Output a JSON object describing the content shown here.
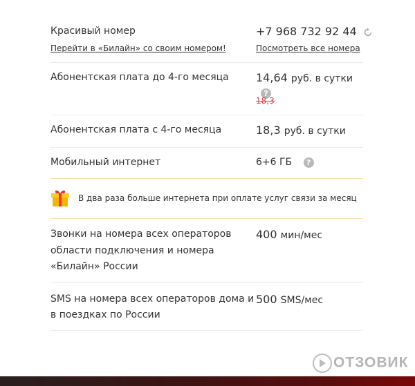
{
  "number_block": {
    "label": "Красивый номер",
    "link": "Перейти в «Билайн» со своим номером!",
    "phone": "+7 968 732 92 44",
    "all_numbers_link": "Посмотреть все номера"
  },
  "fee_before": {
    "label": "Абонентская плата до 4-го месяца",
    "value": "14,64",
    "unit": "руб. в сутки",
    "old_value": "18,3"
  },
  "fee_after": {
    "label": "Абонентская плата с 4-го месяца",
    "value": "18,3",
    "unit": "руб. в сутки"
  },
  "internet": {
    "label": "Мобильный интернет",
    "value": "6+6 ГБ"
  },
  "promo": {
    "text": "В два раза больше интернета при оплате услуг связи за месяц"
  },
  "calls": {
    "label_line1": "Звонки на номера всех операторов",
    "label_line2": "области подключения и номера",
    "label_line3": "«Билайн» России",
    "value": "400",
    "unit": "мин/мес"
  },
  "sms": {
    "label_line1": "SMS на номера всех операторов дома и",
    "label_line2": "в поездках по России",
    "value": "500",
    "unit": "SMS/мес"
  },
  "help_glyph": "?",
  "watermark": "ОТЗОВИК",
  "colors": {
    "accent": "#f5c400",
    "old_price": "#e03a3a",
    "help": "#b9b9b9"
  }
}
